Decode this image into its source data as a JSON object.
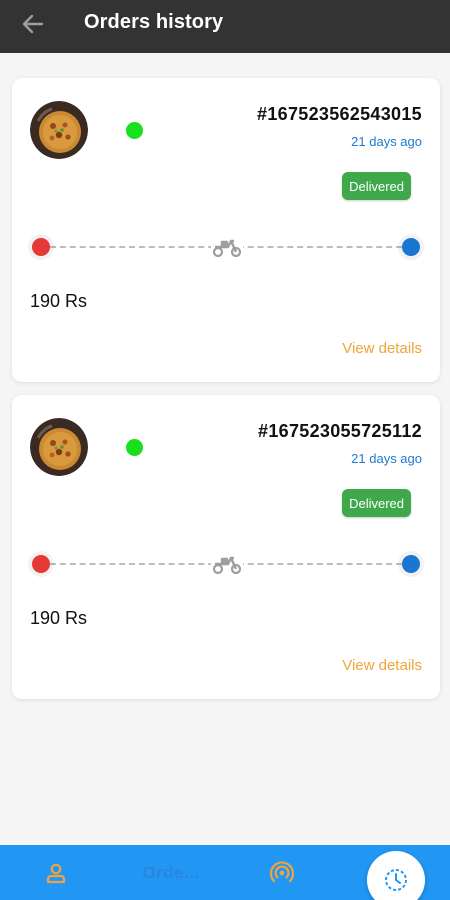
{
  "header": {
    "title": "Orders history",
    "back_icon": "arrow-left-icon"
  },
  "orders": [
    {
      "order_id": "#167523562543015",
      "time_ago": "21 days ago",
      "status": "Delivered",
      "price": "190 Rs",
      "view_details": "View details"
    },
    {
      "order_id": "#167523055725112",
      "time_ago": "21 days ago",
      "status": "Delivered",
      "price": "190 Rs",
      "view_details": "View details"
    }
  ],
  "bottom_nav": {
    "items": [
      {
        "icon": "person-icon"
      },
      {
        "label": "Orde...",
        "icon": "orders-icon"
      },
      {
        "icon": "broadcast-icon"
      },
      {
        "icon": "clock-history-icon",
        "active": true
      }
    ]
  },
  "colors": {
    "appbar": "#333333",
    "accent": "#2196f3",
    "status_online": "#18e01c",
    "badge": "#3ea84a",
    "link": "#f2a33a",
    "time": "#1e7ad1",
    "pin_start": "#e53935",
    "pin_end": "#1976d2"
  }
}
